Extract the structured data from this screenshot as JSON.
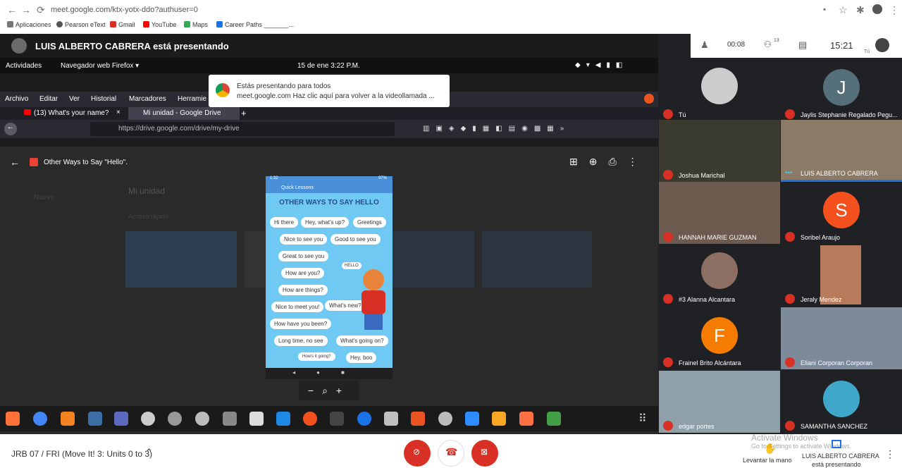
{
  "browser": {
    "url": "meet.google.com/ktx-yotx-ddo?authuser=0",
    "bookmarks": [
      "Aplicaciones",
      "Pearson eText",
      "Gmail",
      "YouTube",
      "Maps",
      "Career Paths _______..."
    ]
  },
  "presenting_banner": "LUIS ALBERTO CABRERA está presentando",
  "ubuntu": {
    "activities": "Actividades",
    "app": "Navegador web Firefox ▾",
    "datetime": "15 de ene  3:22 P.M."
  },
  "notice": {
    "line1": "Estás presentando para todos",
    "line2": "meet.google.com   Haz clic aquí para volver a la videollamada ..."
  },
  "firefox": {
    "menu": [
      "Archivo",
      "Editar",
      "Ver",
      "Historial",
      "Marcadores",
      "Herramie"
    ],
    "tabs": [
      "(13) What's your name?",
      "Mi unidad - Google Drive"
    ],
    "url": "https://drive.google.com/drive/my-drive"
  },
  "drive": {
    "file_title": "Other Ways to Say \"Hello\".",
    "my_drive": "Mi unidad",
    "new": "Nuevo",
    "quick": "Acceso rápido"
  },
  "phone": {
    "time": "1:32",
    "battery": "97%",
    "app": "Quick Lessons",
    "heading": "OTHER WAYS TO SAY HELLO",
    "hello": "HELLO",
    "chips": [
      "Hi there",
      "Hey, what's up?",
      "Greetings",
      "Nice to see you",
      "Good to see you",
      "Great to see you",
      "How are you?",
      "How are things?",
      "Nice to meet you!",
      "What's new?",
      "How have you been?",
      "Long time, no see",
      "What's going on?",
      "How's it going?",
      "Hey, boo"
    ]
  },
  "meet_top": {
    "timer": "00:08",
    "participants": "13",
    "clock": "15:21",
    "you": "Tú"
  },
  "participants": [
    "Tú",
    "Jaylis Stephanie Regalado Pegu...",
    "Joshua Marichal",
    "LUIS ALBERTO CABRERA",
    "HANNAH MARIE GUZMAN",
    "Soribel Araujo",
    "#3 Alanna Alcantara",
    "Jeraly Mendez",
    "Frainel Brito Alcántara",
    "Eliani Corporan Corporan",
    "edgar portes",
    "SAMANTHA SANCHEZ"
  ],
  "avatars": {
    "jaylis": "J",
    "soribel": "S",
    "frainel": "F"
  },
  "bottom": {
    "meeting": "JRB 07 / FRI (Move It! 3: Units 0 to 3)",
    "raise": "Levantar la mano",
    "presenter": "LUIS ALBERTO CABRERA",
    "presenting": "está presentando",
    "watermark1": "Activate Windows",
    "watermark2": "Go to Settings to activate Windows."
  },
  "colors": {
    "red": "#d93025",
    "accent": "#1a73e8",
    "orange": "#f4511e",
    "slate": "#546e7a"
  }
}
